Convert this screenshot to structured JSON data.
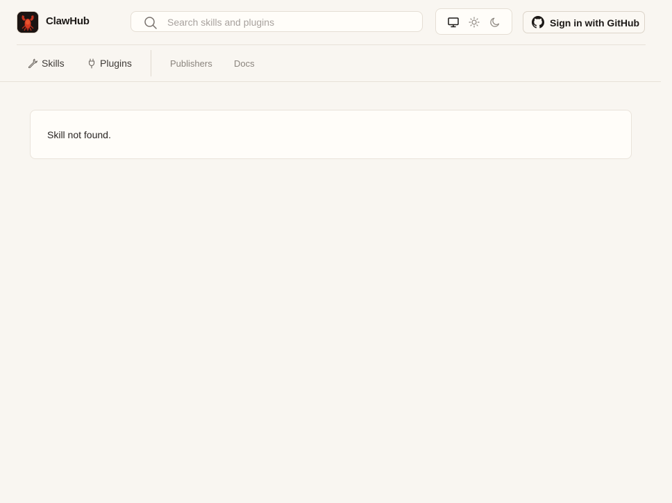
{
  "header": {
    "brand": "ClawHub",
    "logo_icon": "lobster-logo-icon",
    "search": {
      "placeholder": "Search skills and plugins",
      "value": ""
    },
    "theme_toggle": {
      "options": [
        "system-monitor-icon",
        "sun-icon",
        "moon-icon"
      ],
      "selected": "system-monitor-icon"
    },
    "signin_label": "Sign in with GitHub"
  },
  "nav": {
    "primary": [
      {
        "label": "Skills",
        "icon": "wrench-icon"
      },
      {
        "label": "Plugins",
        "icon": "plug-icon"
      }
    ],
    "secondary": [
      {
        "label": "Publishers"
      },
      {
        "label": "Docs"
      }
    ]
  },
  "main": {
    "message": "Skill not found."
  },
  "colors": {
    "background": "#f9f6f1",
    "card": "#fffdf9",
    "border": "#e7e1d8",
    "text": "#1c1917",
    "muted": "#8a847d"
  }
}
